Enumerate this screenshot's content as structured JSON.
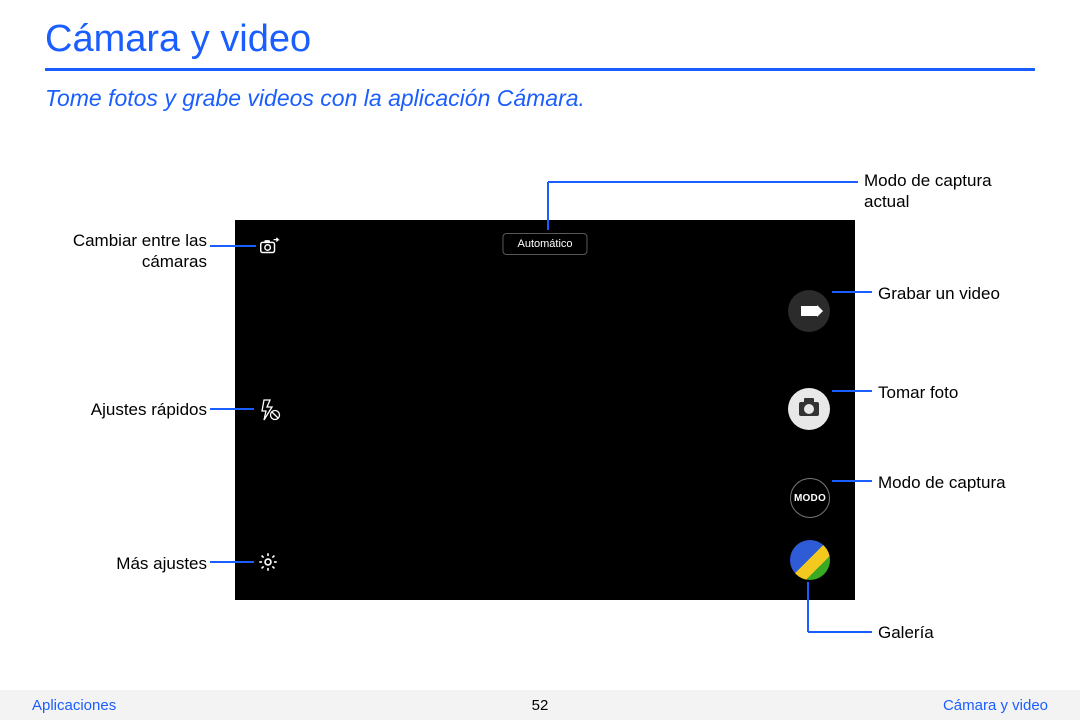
{
  "header": {
    "title": "Cámara y video",
    "subtitle": "Tome fotos y grabe videos con la aplicación Cámara."
  },
  "camera_ui": {
    "mode_label": "Automático",
    "modo_button_text": "MODO"
  },
  "callouts": {
    "switch_cameras": "Cambiar entre las cámaras",
    "quick_settings": "Ajustes rápidos",
    "more_settings": "Más ajustes",
    "current_capture_mode": "Modo de captura actual",
    "record_video": "Grabar un video",
    "take_photo": "Tomar foto",
    "capture_mode": "Modo de captura",
    "gallery": "Galería"
  },
  "footer": {
    "left": "Aplicaciones",
    "page": "52",
    "right": "Cámara y video"
  }
}
